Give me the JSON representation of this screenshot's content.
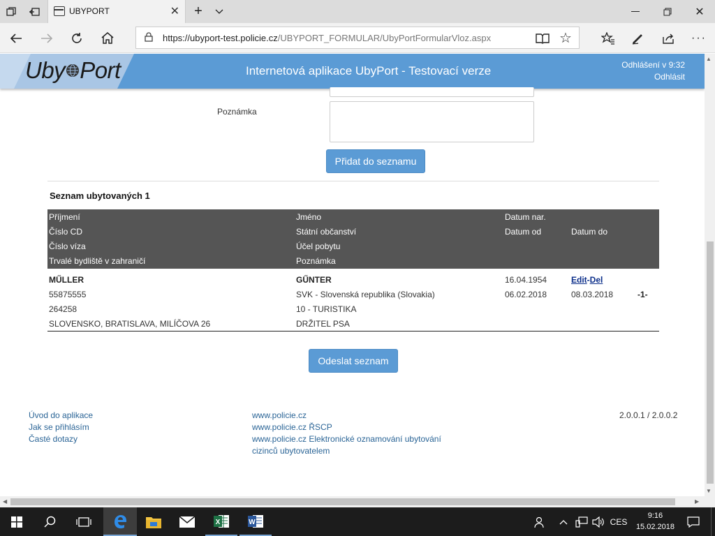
{
  "browser": {
    "tab_title": "UBYPORT",
    "url_host": "https://ubyport-test.policie.cz",
    "url_path": "/UBYPORT_FORMULAR/UbyPortFormularVloz.aspx"
  },
  "header": {
    "logo_uby": "Uby",
    "logo_port": "Port",
    "title": "Internetová aplikace UbyPort - Testovací verze",
    "login_status": "Odhlášení v 9:32",
    "logout": "Odhlásit"
  },
  "form": {
    "note_label": "Poznámka",
    "add_button": "Přidat do seznamu"
  },
  "list": {
    "title": "Seznam ubytovaných 1",
    "headers": {
      "surname": "Příjmení",
      "name": "Jméno",
      "birth_date": "Datum nar.",
      "cd_number": "Číslo CD",
      "citizenship": "Státní občanství",
      "date_from": "Datum od",
      "date_to": "Datum do",
      "visa_number": "Číslo víza",
      "stay_purpose": "Účel pobytu",
      "residence": "Trvalé bydliště v zahraničí",
      "note": "Poznámka"
    },
    "rows": [
      {
        "surname": "MŰLLER",
        "name": "GŰNTER",
        "birth_date": "16.04.1954",
        "edit": "Edit",
        "sep": "-",
        "del": "Del",
        "cd_number": "55875555",
        "citizenship": "SVK - Slovenská republika (Slovakia)",
        "date_from": "06.02.2018",
        "date_to": "08.03.2018",
        "index": "-1-",
        "visa_number": "264258",
        "stay_purpose": "10 - TURISTIKA",
        "residence": "SLOVENSKO, BRATISLAVA, MILÍČOVA 26",
        "note": "DRŽITEL PSA"
      }
    ],
    "submit_button": "Odeslat seznam"
  },
  "footer": {
    "left_links": [
      "Úvod do aplikace",
      "Jak se přihlásím",
      "Časté dotazy"
    ],
    "mid_links": [
      "www.policie.cz",
      "www.policie.cz ŘSCP",
      "www.policie.cz Elektronické oznamování ubytování",
      "cizinců ubytovatelem"
    ],
    "version": "2.0.0.1 / 2.0.0.2"
  },
  "taskbar": {
    "language": "CES",
    "time": "9:16",
    "date": "15.02.2018"
  }
}
